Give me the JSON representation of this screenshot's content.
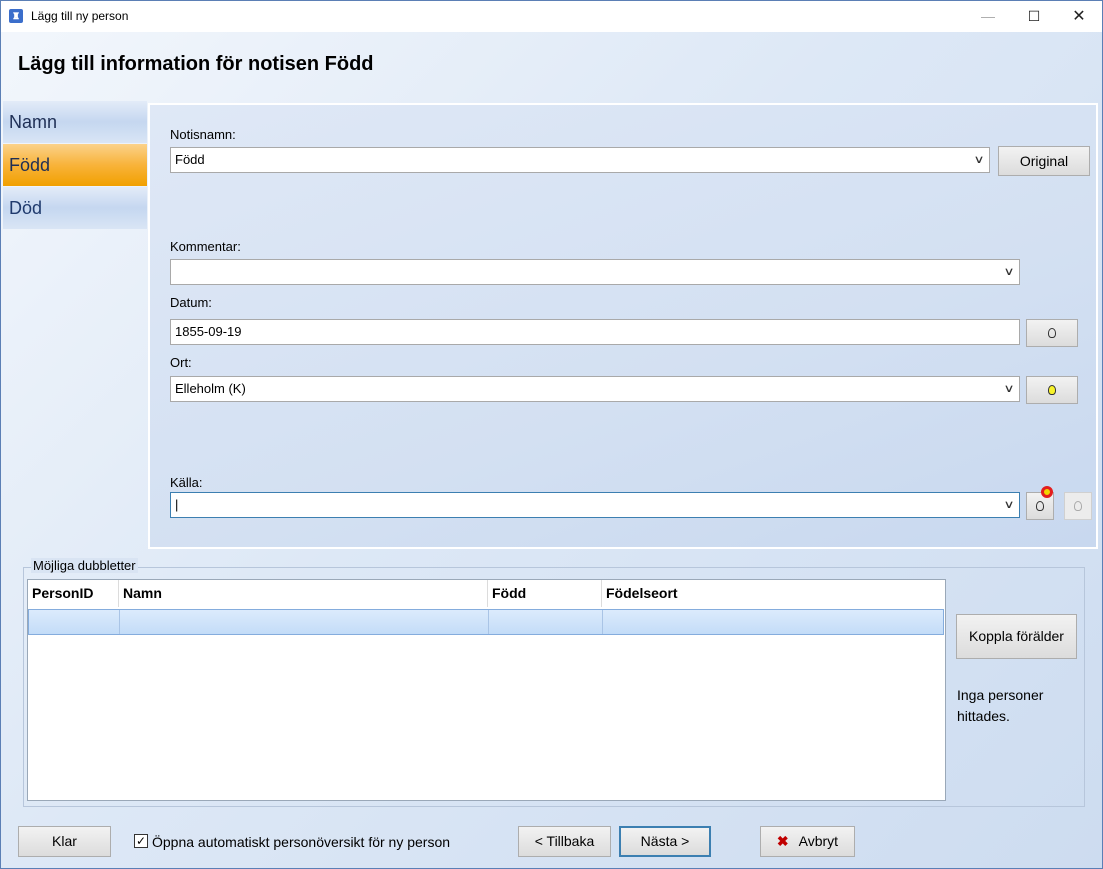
{
  "window": {
    "title": "Lägg till ny person",
    "icon": "tree-icon",
    "min": "—",
    "max": "☐",
    "close": "✕"
  },
  "heading": "Lägg till information för notisen Född",
  "nav": {
    "items": [
      "Namn",
      "Född",
      "Död"
    ],
    "selected": "Född"
  },
  "form": {
    "notisnamn_label": "Notisnamn:",
    "notisnamn_value": "Född",
    "original_button": "Original",
    "kommentar_label": "Kommentar:",
    "kommentar_value": "",
    "datum_label": "Datum:",
    "datum_value": "1855-09-19",
    "ort_label": "Ort:",
    "ort_value": "Elleholm (K)",
    "kalla_label": "Källa:",
    "kalla_value": "|"
  },
  "duplicates": {
    "title": "Möjliga dubbletter",
    "columns": [
      "PersonID",
      "Namn",
      "Född",
      "Födelseort"
    ],
    "rows": [],
    "link_parent_button": "Koppla förälder",
    "message": "Inga personer hittades."
  },
  "footer": {
    "done_button": "Klar",
    "checkbox_label": "Öppna automatiskt personöversikt för ny person",
    "checkbox_checked": true,
    "checkmark": "✓",
    "back_button": "< Tillbaka",
    "next_button": "Nästa >",
    "cancel_button": "Avbryt",
    "cancel_icon": "✖"
  },
  "colors": {
    "nav_selected": "#f8b33a",
    "accent": "#3c7fb1",
    "cancel_icon": "#c00000"
  }
}
